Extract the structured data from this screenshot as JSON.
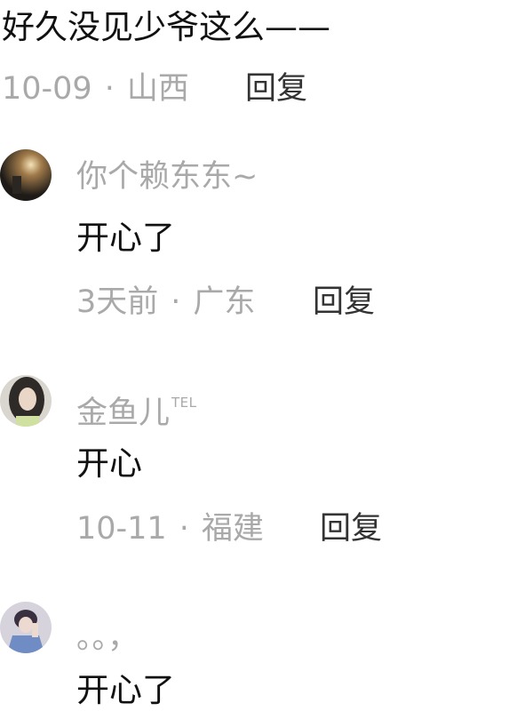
{
  "top_comment": {
    "text": "好久没见少爷这么——",
    "date": "10-09",
    "location": "山西",
    "reply_label": "回复"
  },
  "replies": [
    {
      "username": "你个赖东东~",
      "text": "开心了",
      "date": "3天前",
      "location": "广东",
      "reply_label": "回复"
    },
    {
      "username": "金鱼儿",
      "badge": "TEL",
      "text": "开心",
      "date": "10-11",
      "location": "福建",
      "reply_label": "回复"
    },
    {
      "username": "。。，",
      "text": "开心了"
    }
  ],
  "separator": "·"
}
